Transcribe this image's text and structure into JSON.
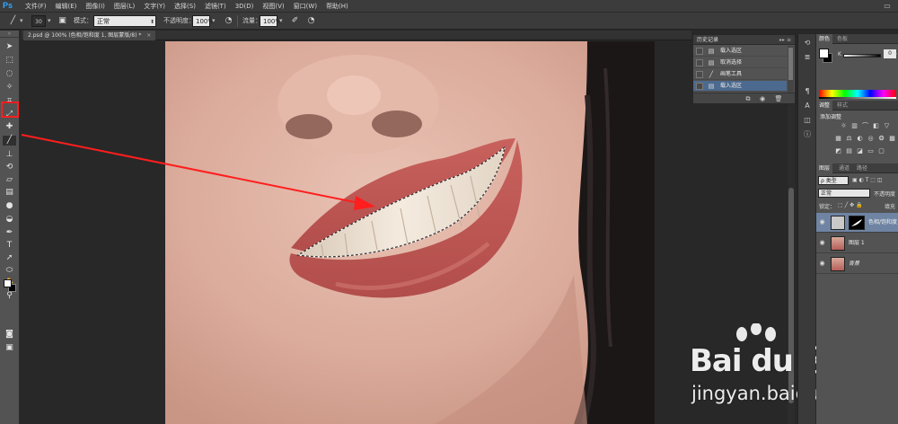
{
  "app": {
    "logo": "Ps"
  },
  "menu": [
    "文件(F)",
    "编辑(E)",
    "图像(I)",
    "图层(L)",
    "文字(Y)",
    "选择(S)",
    "滤镜(T)",
    "3D(D)",
    "视图(V)",
    "窗口(W)",
    "帮助(H)"
  ],
  "window_controls": {
    "restore_icon": "▭"
  },
  "options": {
    "brush_size": "30",
    "mode_label": "模式：",
    "mode_value": "正常",
    "opacity_label": "不透明度：",
    "opacity_value": "100%",
    "flow_label": "流量：",
    "flow_value": "100%"
  },
  "document": {
    "tab_title": "2.psd @ 100% (色相/饱和度 1, 图层蒙版/8) *",
    "close": "×"
  },
  "history": {
    "title": "历史记录",
    "menu_icon": "▸▸ ≡",
    "items": [
      {
        "label": "载入选区",
        "icon": "▤",
        "active": false
      },
      {
        "label": "取消选择",
        "icon": "▤",
        "active": false
      },
      {
        "label": "画笔工具",
        "icon": "╱",
        "active": false
      },
      {
        "label": "载入选区",
        "icon": "▤",
        "active": true
      }
    ]
  },
  "color_panel": {
    "tabs": [
      "颜色",
      "色板"
    ],
    "channel": "K",
    "value": "0",
    "unit": "%",
    "fg_color": "#ffffff",
    "bg_color": "#000000"
  },
  "adjustments_panel": {
    "tabs": [
      "调整",
      "样式"
    ],
    "add_label": "添加调整"
  },
  "layers_panel": {
    "tabs": [
      "图层",
      "通道",
      "路径"
    ],
    "filter": "ρ 类型",
    "blend_mode": "正常",
    "opacity_label": "不透明度",
    "lock_label": "锁定：",
    "fill_label": "填充",
    "layers": [
      {
        "name": "色相/饱和度",
        "selected": true,
        "type": "adjustment"
      },
      {
        "name": "图层 1",
        "selected": false,
        "type": "image"
      },
      {
        "name": "背景",
        "selected": false,
        "type": "image"
      }
    ]
  },
  "watermark": {
    "brand": "Bai du 经验",
    "site": "jingyan.baidu.com"
  },
  "accent_colors": {
    "annotation": "#ff1e1e",
    "history_selected": "#4c6a8f",
    "layer_selected": "#6f84a3"
  }
}
